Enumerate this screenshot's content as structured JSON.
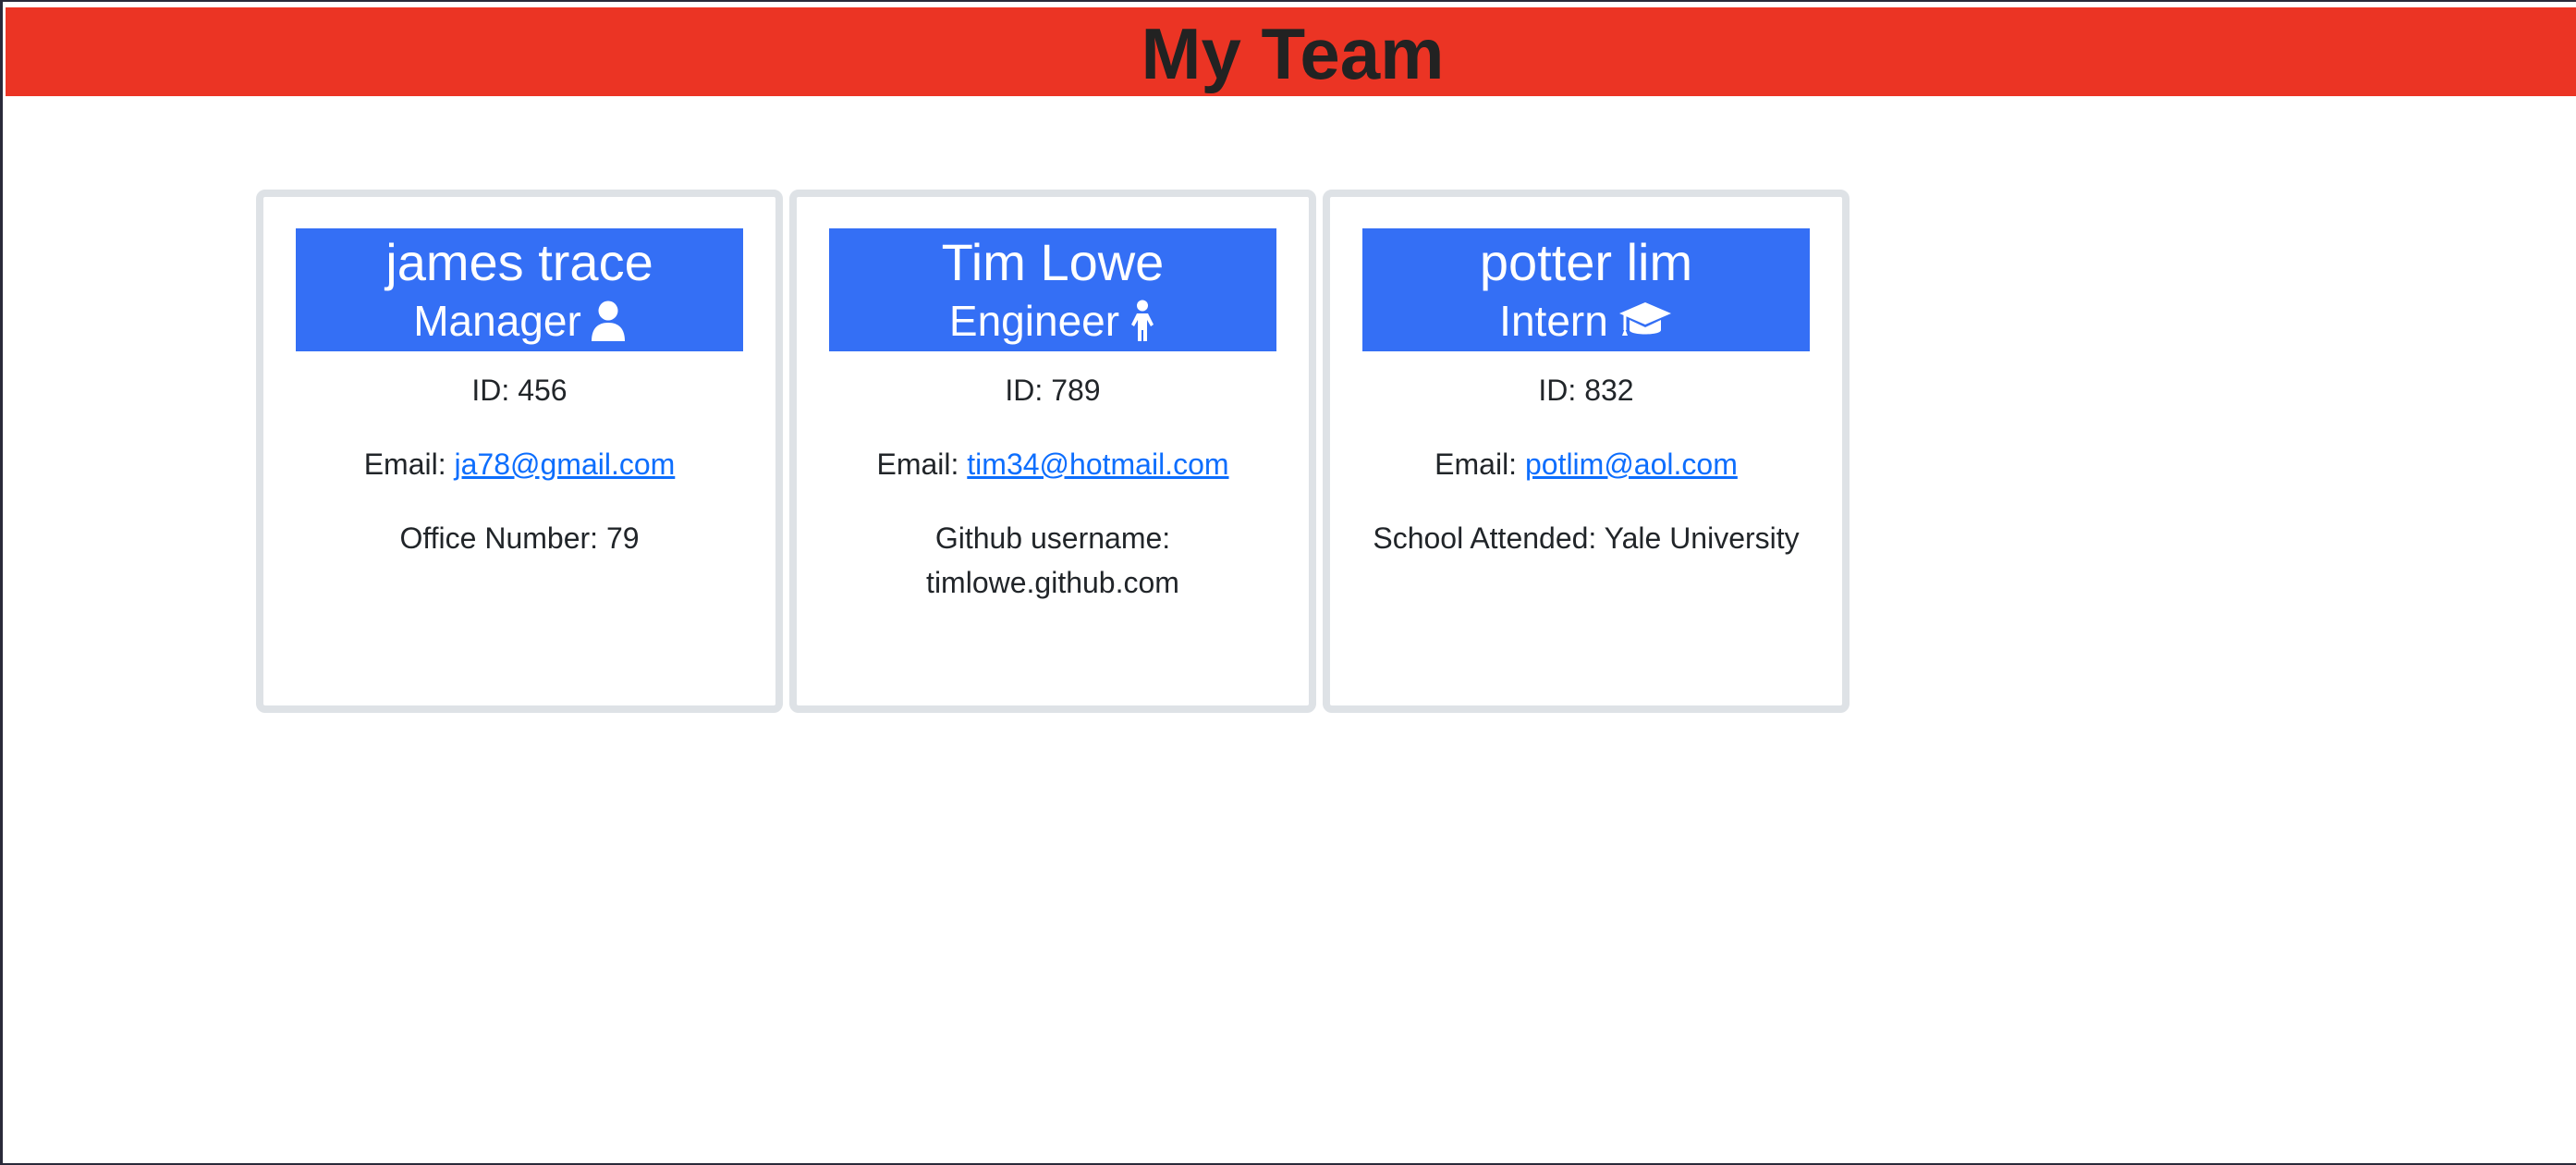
{
  "header": {
    "title": "My Team"
  },
  "employees": [
    {
      "name": "james trace",
      "role": "Manager",
      "icon": "person-icon",
      "id_label": "ID:",
      "id": "456",
      "email_label": "Email:",
      "email": "ja78@gmail.com",
      "extra_label": "Office Number:",
      "extra": "79"
    },
    {
      "name": "Tim Lowe",
      "role": "Engineer",
      "icon": "child-icon",
      "id_label": "ID:",
      "id": "789",
      "email_label": "Email:",
      "email": "tim34@hotmail.com",
      "extra_label": "Github username:",
      "extra": "timlowe.github.com"
    },
    {
      "name": "potter lim",
      "role": "Intern",
      "icon": "graduation-cap-icon",
      "id_label": "ID:",
      "id": "832",
      "email_label": "Email:",
      "email": "potlim@aol.com",
      "extra_label": "School Attended:",
      "extra": "Yale University"
    }
  ],
  "colors": {
    "header_bg": "#eb3424",
    "card_head_bg": "#346ff5",
    "link": "#0d6efd"
  }
}
